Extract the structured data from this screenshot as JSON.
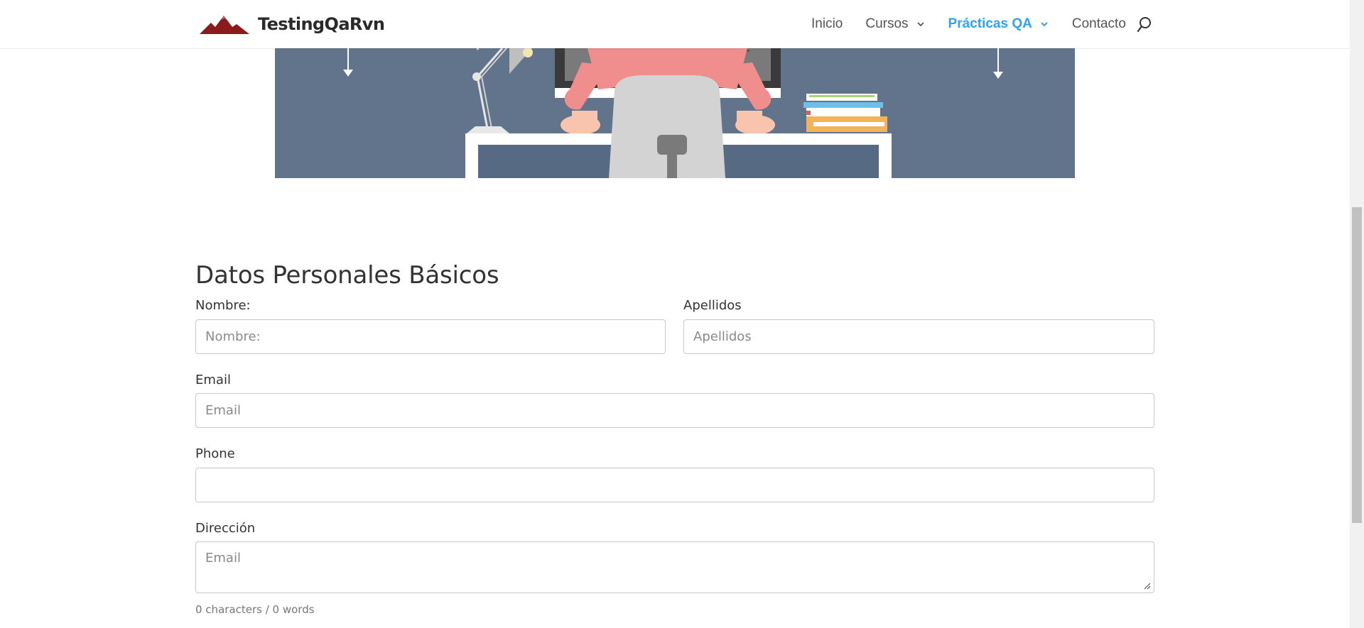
{
  "brand": {
    "name": "TestingQaRvn"
  },
  "nav": {
    "items": [
      {
        "label": "Inicio"
      },
      {
        "label": "Cursos"
      },
      {
        "label": "Prácticas QA"
      },
      {
        "label": "Contacto"
      }
    ],
    "active_color": "#2ea3f2"
  },
  "form": {
    "title": "Datos Personales Básicos",
    "nombre": {
      "label": "Nombre:",
      "placeholder": "Nombre:",
      "value": ""
    },
    "apellidos": {
      "label": "Apellidos",
      "placeholder": "Apellidos",
      "value": ""
    },
    "email": {
      "label": "Email",
      "placeholder": "Email",
      "value": ""
    },
    "phone": {
      "label": "Phone",
      "placeholder": "",
      "value": ""
    },
    "direccion": {
      "label": "Dirección",
      "placeholder": "Email",
      "value": ""
    },
    "counter": "0 characters / 0 words"
  },
  "icons": {
    "logo": "mountain-logo-icon",
    "dropdown": "chevron-down-icon",
    "search": "search-icon"
  }
}
